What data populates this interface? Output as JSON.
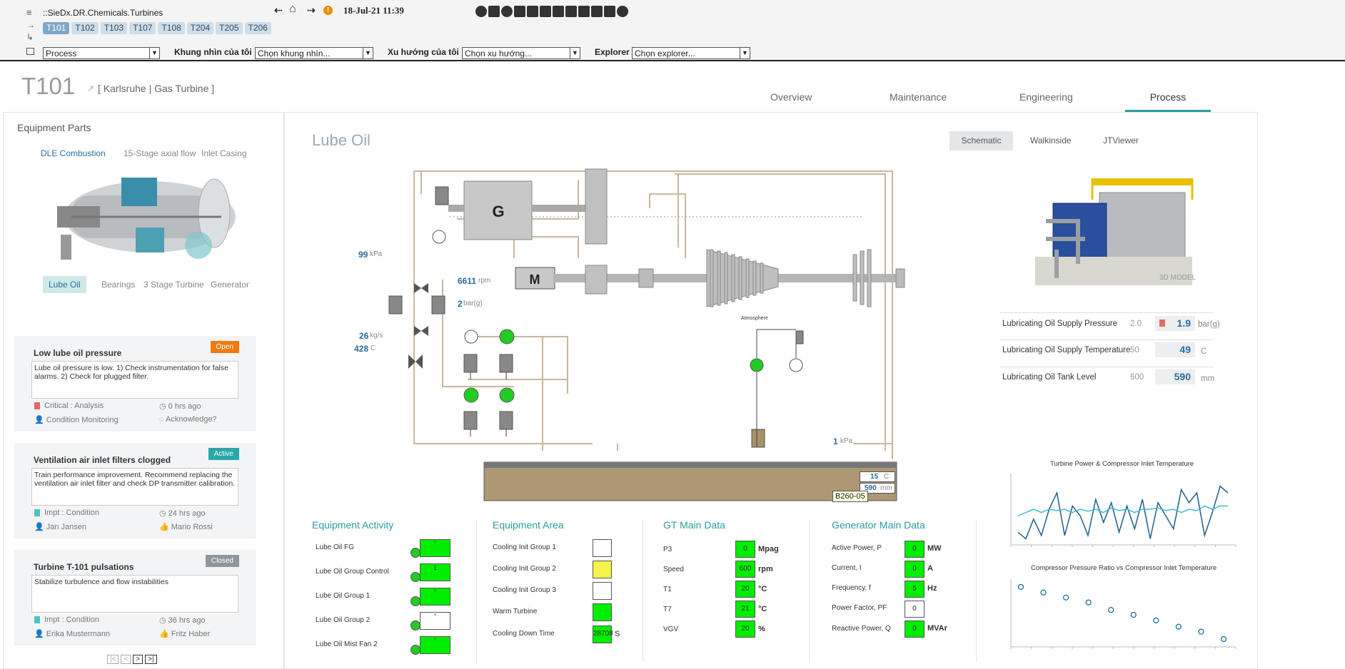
{
  "header": {
    "breadcrumb": "::SieDx.DR.Chemicals.Turbines",
    "turbines": [
      "T101",
      "T102",
      "T103",
      "T107",
      "T108",
      "T204",
      "T205",
      "T206"
    ],
    "datetime": "18-Jul-21 11:39",
    "alert_icon": "!",
    "view_select": "Process",
    "my_view_label": "Khung nhìn của tôi",
    "my_view_value": "Chọn khung nhìn...",
    "trend_label": "Xu hướng của tôi",
    "trend_value": "Chọn xu hướng...",
    "explorer_label": "Explorer",
    "explorer_value": "Chọn explorer..."
  },
  "asset": {
    "id": "T101",
    "location": "[ Karlsruhe | Gas Turbine ]"
  },
  "tabs": [
    "Overview",
    "Maintenance",
    "Engineering",
    "Process"
  ],
  "equipment_parts": {
    "title": "Equipment Parts",
    "top_links": [
      "DLE Combustion",
      "15-Stage axial flow",
      "Inlet Casing"
    ],
    "bottom_links": [
      "Lube Oil",
      "Bearings",
      "3 Stage Turbine",
      "Generator"
    ]
  },
  "alerts": [
    {
      "title": "Low lube oil pressure",
      "status": "Open",
      "desc": "Lube oil pressure is low. 1) Check instrumentation for false alarms. 2) Check for plugged filter.",
      "severity": "Critical : Analysis",
      "time": "0 hrs ago",
      "owner": "Condition Monitoring",
      "action": "Acknowledge?"
    },
    {
      "title": "Ventilation air inlet filters clogged",
      "status": "Active",
      "desc": "Train performance improvement. Recommend replacing the ventilation air inlet filter and check DP transmitter calibration.",
      "severity": "Impt : Condition",
      "time": "24 hrs ago",
      "owner": "Jan Jansen",
      "action": "Mario Rossi"
    },
    {
      "title": "Turbine T-101 pulsations",
      "status": "Closed",
      "desc": "Stabilize turbulence and flow instabilities",
      "severity": "Impt : Condition",
      "time": "36 hrs ago",
      "owner": "Erika Mustermann",
      "action": "Fritz Haber"
    }
  ],
  "pager": [
    "|<",
    "<",
    ">",
    ">|"
  ],
  "main": {
    "title": "Lube Oil",
    "view_tabs": [
      "Schematic",
      "Walkinside",
      "JTViewer"
    ],
    "model_label": "3D MODEL"
  },
  "schematic": {
    "generator": "G",
    "motor": "M",
    "atmosphere": "Atmosphere",
    "p1": {
      "value": "99",
      "unit": "kPa"
    },
    "speed": {
      "value": "6611",
      "unit": "rpm"
    },
    "pressure": {
      "value": "2",
      "unit": "bar(g)"
    },
    "flow": {
      "value": "26",
      "unit": "kg/s"
    },
    "temp": {
      "value": "428",
      "unit": "C"
    },
    "tank_p": {
      "value": "1",
      "unit": "kPa"
    },
    "tank_temp": {
      "value": "15",
      "unit": "C"
    },
    "tank_level": {
      "value": "590",
      "unit": "mm"
    },
    "tag": "B260-05"
  },
  "lube_params": [
    {
      "label": "Lubricating Oil Supply Pressure",
      "setpoint": "2.0",
      "value": "1.9",
      "unit": "bar(g)"
    },
    {
      "label": "Lubricating Oil Supply Temperature",
      "setpoint": "50",
      "value": "49",
      "unit": "C"
    },
    {
      "label": "Lubricating Oil Tank Level",
      "setpoint": "600",
      "value": "590",
      "unit": "mm"
    }
  ],
  "equipment_activity": {
    "title": "Equipment Activity",
    "rows": [
      {
        "label": "Lube Oil FG",
        "value": "°"
      },
      {
        "label": "Lube Oil Group Control",
        "value": "1"
      },
      {
        "label": "Lube Oil Group 1",
        "value": "°"
      },
      {
        "label": "Lube Oil Group 2",
        "value": "°"
      },
      {
        "label": "Lube Oil Mist Fan 2",
        "value": "°"
      }
    ]
  },
  "equipment_area": {
    "title": "Equipment Area",
    "rows": [
      {
        "label": "Cooling Init Group 1",
        "color": "#ffffff"
      },
      {
        "label": "Cooling Init Group 2",
        "color": "#f7f34a"
      },
      {
        "label": "Cooling Init Group 3",
        "color": "#ffffff"
      },
      {
        "label": "Warm Turbine",
        "color": "#00ee00"
      },
      {
        "label": "Cooling Down Time",
        "color": "#00ee00",
        "value": "28708",
        "unit": "S"
      }
    ]
  },
  "gt_main": {
    "title": "GT Main Data",
    "rows": [
      {
        "label": "P3",
        "value": "0",
        "unit": "Mpag"
      },
      {
        "label": "Speed",
        "value": "600",
        "unit": "rpm"
      },
      {
        "label": "T1",
        "value": "20",
        "unit": "°C"
      },
      {
        "label": "T7",
        "value": "21",
        "unit": "°C"
      },
      {
        "label": "VGV",
        "value": "20",
        "unit": "%"
      }
    ]
  },
  "gen_main": {
    "title": "Generator Main Data",
    "rows": [
      {
        "label": "Active Power, P",
        "value": "0",
        "unit": "MW",
        "color": "#00ee00"
      },
      {
        "label": "Current, I",
        "value": "0",
        "unit": "A",
        "color": "#00ee00"
      },
      {
        "label": "Frequency, f",
        "value": "5",
        "unit": "Hz",
        "color": "#00ee00"
      },
      {
        "label": "Power Factor, PF",
        "value": "0",
        "unit": "",
        "color": "#ffffff"
      },
      {
        "label": "Reactive Power, Q",
        "value": "0",
        "unit": "MVAr",
        "color": "#00ee00"
      }
    ]
  },
  "chart_data": [
    {
      "type": "line",
      "title": "Turbine Power & Compressor Inlet Temperature",
      "x": [
        1,
        2,
        3,
        4,
        5,
        6,
        7,
        8,
        9,
        10,
        11,
        12,
        13,
        14,
        15,
        16,
        17,
        18,
        19,
        20,
        21,
        22,
        23,
        24,
        25,
        26,
        27,
        28
      ],
      "series": [
        {
          "color": "#1f5f8b",
          "values": [
            0.15,
            0.05,
            0.35,
            0.1,
            0.5,
            0.75,
            0.1,
            0.55,
            0.4,
            0.1,
            0.65,
            0.3,
            0.6,
            0.15,
            0.55,
            0.2,
            0.65,
            0.05,
            0.6,
            0.4,
            0.2,
            0.8,
            0.6,
            0.75,
            0.1,
            0.45,
            0.85,
            0.75
          ]
        },
        {
          "color": "#3cbcd0",
          "values": [
            0.4,
            0.45,
            0.5,
            0.45,
            0.5,
            0.48,
            0.5,
            0.45,
            0.5,
            0.47,
            0.5,
            0.45,
            0.52,
            0.48,
            0.5,
            0.45,
            0.5,
            0.5,
            0.52,
            0.48,
            0.5,
            0.45,
            0.5,
            0.48,
            0.55,
            0.5,
            0.55,
            0.55
          ]
        }
      ]
    },
    {
      "type": "scatter",
      "title": "Compressor Pressure Ratio vs Compressor Inlet Temperature",
      "x": [
        1,
        2,
        3,
        4,
        5,
        6,
        7,
        8,
        9,
        10
      ],
      "values": [
        0.92,
        0.83,
        0.75,
        0.67,
        0.55,
        0.47,
        0.38,
        0.28,
        0.2,
        0.08
      ]
    }
  ]
}
